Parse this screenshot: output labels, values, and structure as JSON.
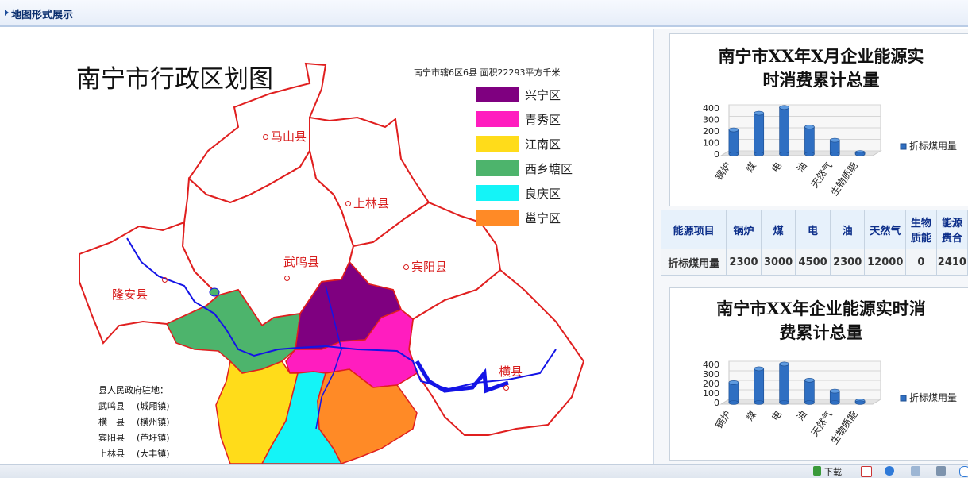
{
  "header": {
    "title": "地图形式展示"
  },
  "map": {
    "title": "南宁市行政区划图",
    "subtitle": "南宁市辖6区6县  面积22293平方千米",
    "legend": [
      {
        "label": "兴宁区",
        "color": "#7f0080"
      },
      {
        "label": "青秀区",
        "color": "#ff1dbf"
      },
      {
        "label": "江南区",
        "color": "#ffdc1a"
      },
      {
        "label": "西乡塘区",
        "color": "#4db46c"
      },
      {
        "label": "良庆区",
        "color": "#14f4f7"
      },
      {
        "label": "邕宁区",
        "color": "#ff8a26"
      }
    ],
    "counties": [
      "马山县",
      "上林县",
      "武鸣县",
      "宾阳县",
      "隆安县",
      "横县"
    ],
    "seat_note": {
      "heading": "县人民政府驻地：",
      "rows": [
        {
          "county": "武鸣县",
          "seat": "(城厢镇)"
        },
        {
          "county": "横　县",
          "seat": "(横州镇)"
        },
        {
          "county": "宾阳县",
          "seat": "(芦圩镇)"
        },
        {
          "county": "上林县",
          "seat": "(大丰镇)"
        }
      ]
    }
  },
  "chart1_title": {
    "line1": "南宁市XX年X月企业能源实",
    "line2": "时消费累计总量"
  },
  "chart2_title": {
    "line1": "南宁市XX年企业能源实时消",
    "line2": "费累计总量"
  },
  "chart_data": [
    {
      "type": "bar",
      "title": "南宁市XX年X月企业能源实时消费累计总量",
      "categories": [
        "锅炉",
        "煤",
        "电",
        "油",
        "天然气",
        "生物质能"
      ],
      "series": [
        {
          "name": "折标煤用量",
          "values": [
            210,
            355,
            405,
            235,
            120,
            5
          ]
        }
      ],
      "yticks": [
        "0",
        "100",
        "200",
        "300",
        "400"
      ],
      "ylim": [
        0,
        400
      ],
      "legend": "right",
      "color": "#2f6fc2"
    },
    {
      "type": "bar",
      "title": "南宁市XX年企业能源实时消费累计总量",
      "categories": [
        "锅炉",
        "煤",
        "电",
        "油",
        "天然气",
        "生物质能"
      ],
      "series": [
        {
          "name": "折标煤用量",
          "values": [
            210,
            355,
            405,
            235,
            120,
            5
          ]
        }
      ],
      "yticks": [
        "0",
        "100",
        "200",
        "300",
        "400"
      ],
      "ylim": [
        0,
        400
      ],
      "legend": "right",
      "color": "#2f6fc2"
    }
  ],
  "table": {
    "headers": [
      "能源项目",
      "锅炉",
      "煤",
      "电",
      "油",
      "天然气",
      "生物质能",
      "能源综合消费合计"
    ],
    "header_display": [
      "能源项目",
      "锅炉",
      "煤",
      "电",
      "油",
      "天然气",
      "生物\n质能",
      "能源\n费合"
    ],
    "row_label": "折标煤用量",
    "row_values": [
      "2300",
      "3000",
      "4500",
      "2300",
      "12000",
      "0",
      "2410"
    ]
  },
  "statusbar": {
    "download": "下载"
  }
}
